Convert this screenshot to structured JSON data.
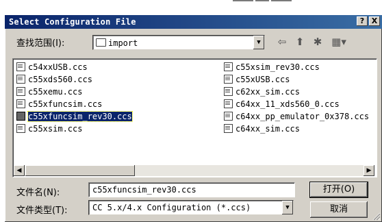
{
  "window": {
    "title": "Select Configuration File"
  },
  "titlebar_buttons": {
    "help": "?",
    "close": "X"
  },
  "lookin": {
    "label": "查找范围(I):",
    "value": "import"
  },
  "toolbar_icons": [
    "back-arrow-icon",
    "up-folder-icon",
    "new-folder-icon",
    "view-menu-icon"
  ],
  "files_col1": [
    "c54xxUSB.ccs",
    "c55xds560.ccs",
    "c55xemu.ccs",
    "c55xfuncsim.ccs",
    "c55xfuncsim_rev30.ccs",
    "c55xsim.ccs"
  ],
  "files_col2": [
    "c55xsim_rev30.ccs",
    "c55xUSB.ccs",
    "c62xx_sim.ccs",
    "c64xx_11_xds560_0.ccs",
    "c64xx_pp_emulator_0x378.ccs",
    "c64xx_sim.ccs"
  ],
  "selected_file": "c55xfuncsim_rev30.ccs",
  "filename": {
    "label": "文件名(N):",
    "value": "c55xfuncsim_rev30.ccs"
  },
  "filetype": {
    "label": "文件类型(T):",
    "value": "CC 5.x/4.x Configuration (*.ccs)"
  },
  "buttons": {
    "open": "打开(O)",
    "cancel": "取消"
  }
}
